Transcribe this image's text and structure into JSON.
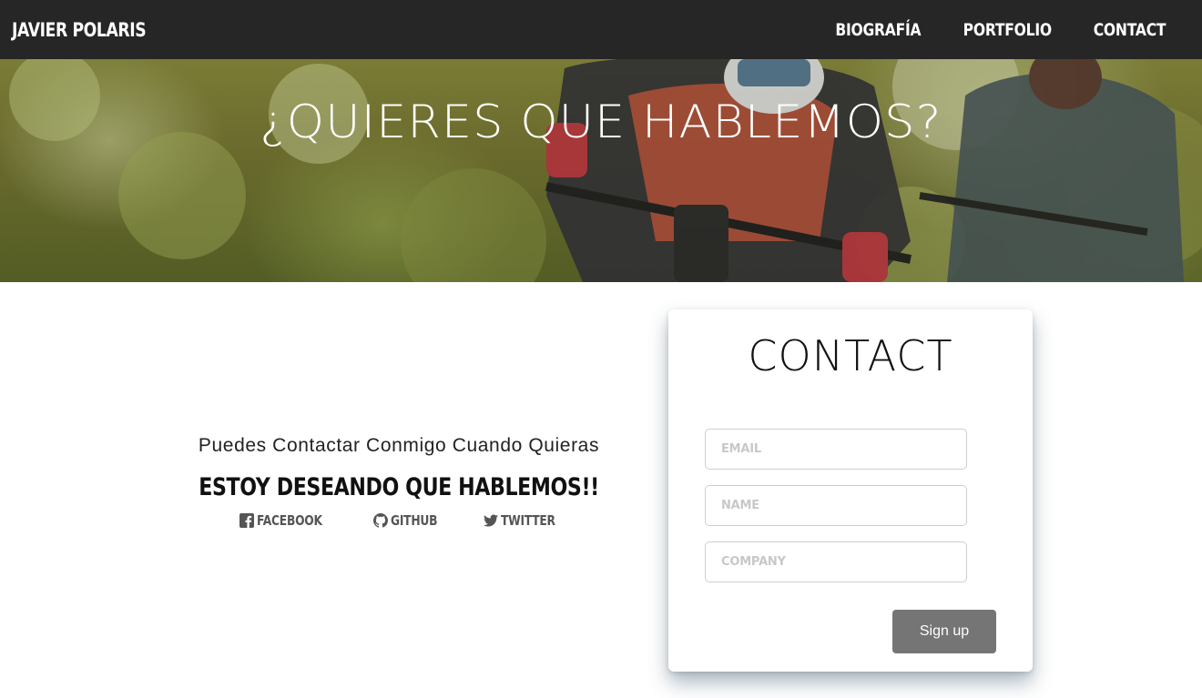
{
  "nav": {
    "brand": "JAVIER POLARIS",
    "links": [
      "BIOGRAFÍA",
      "PORTFOLIO",
      "CONTACT"
    ]
  },
  "hero": {
    "title": "¿QUIERES QUE HABLEMOS?"
  },
  "info": {
    "subtitle": "Puedes Contactar Conmigo Cuando Quieras",
    "title": "ESTOY DESEANDO QUE HABLEMOS!!",
    "socials": [
      {
        "label": "FACEBOOK",
        "icon": "facebook-icon"
      },
      {
        "label": "GITHUB",
        "icon": "github-icon"
      },
      {
        "label": "TWITTER",
        "icon": "twitter-icon"
      }
    ]
  },
  "contact": {
    "title": "CONTACT",
    "email_placeholder": "EMAIL",
    "name_placeholder": "NAME",
    "company_placeholder": "COMPANY",
    "submit_label": "Sign up"
  },
  "colors": {
    "navbar": "#262626",
    "button": "#757575"
  }
}
